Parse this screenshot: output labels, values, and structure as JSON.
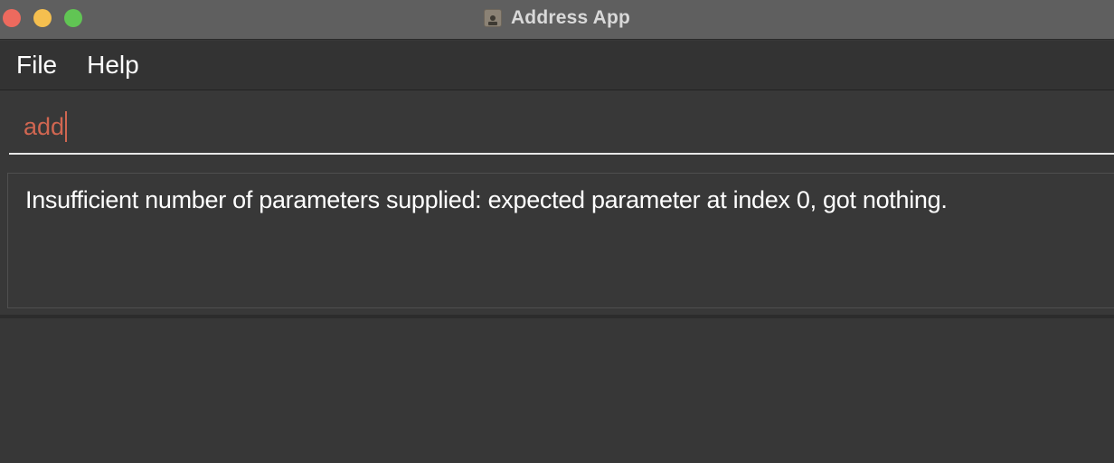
{
  "window": {
    "title": "Address App",
    "controls": [
      "close",
      "minimize",
      "zoom"
    ]
  },
  "menu": {
    "items": [
      {
        "label": "File"
      },
      {
        "label": "Help"
      }
    ]
  },
  "command_box": {
    "value": "add",
    "text_color": "#d06651"
  },
  "result_display": {
    "message": "Insufficient number of parameters supplied: expected parameter at index 0, got nothing."
  },
  "icons": {
    "app": "address-book-icon"
  },
  "colors": {
    "titlebar": "#5f5f5f",
    "background": "#383838",
    "close": "#ed6a5e",
    "minimize": "#f5bf4f",
    "zoom": "#61c554"
  }
}
